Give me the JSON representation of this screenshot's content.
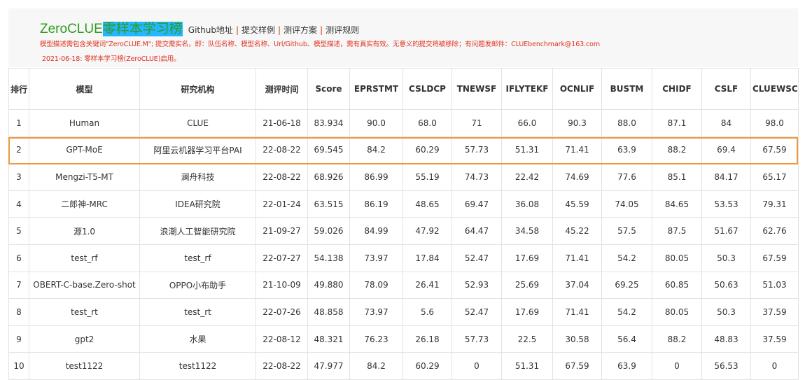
{
  "header": {
    "brand_prefix": "ZeroCLUE",
    "brand_highlight": "零样本学习榜",
    "nav": [
      "Github地址",
      "提交样例",
      "测评方案",
      "测评规则"
    ]
  },
  "notice": {
    "line1": "模型描述需包含关键词\"ZeroCLUE.M\"; 提交需实名，即：队伍名称、模型名称、Url/Github、模型描述，需有真实有效。无意义的提交将被移除；有问题发邮件：CLUEbenchmark@163.com",
    "line2": "2021-06-18: 零样本学习榜(ZeroCLUE)启用。"
  },
  "colors": {
    "brand": "#2f9a1f",
    "brand_highlight_bg": "#22b7ff",
    "notice": "#e0301e",
    "model_link": "#3b5fc0",
    "best_value": "#e0301e",
    "selected_row_outline": "#f0973a"
  },
  "table": {
    "columns": [
      "排行",
      "模型",
      "研究机构",
      "测评时间",
      "Score",
      "EPRSTMT",
      "CSLDCP",
      "TNEWSF",
      "IFLYTEKF",
      "OCNLIF",
      "BUSTM",
      "CHIDF",
      "CSLF",
      "CLUEWSCF"
    ],
    "highlighted_rank": "2",
    "rows": [
      {
        "rank": "1",
        "model": "Human",
        "org": "CLUE",
        "date": "21-06-18",
        "score": "83.934",
        "eprstmt": "90.0",
        "csldcp": "68.0",
        "tnewsf": "71",
        "iflytekf": "66.0",
        "ocnlif": "90.3",
        "bustm": "88.0",
        "chidf": "87.1",
        "cslf": "84",
        "cluewscf": "98.0",
        "red": [
          "score",
          "eprstmt",
          "csldcp",
          "iflytekf",
          "ocnlif",
          "bustm",
          "cluewscf"
        ]
      },
      {
        "rank": "2",
        "model": "GPT-MoE",
        "org": "阿里云机器学习平台PAI",
        "date": "22-08-22",
        "score": "69.545",
        "eprstmt": "84.2",
        "csldcp": "60.29",
        "tnewsf": "57.73",
        "iflytekf": "51.31",
        "ocnlif": "71.41",
        "bustm": "63.9",
        "chidf": "88.2",
        "cslf": "69.4",
        "cluewscf": "67.59",
        "red": []
      },
      {
        "rank": "3",
        "model": "Mengzi-T5-MT",
        "org": "澜舟科技",
        "date": "22-08-22",
        "score": "68.926",
        "eprstmt": "86.99",
        "csldcp": "55.19",
        "tnewsf": "74.73",
        "iflytekf": "22.42",
        "ocnlif": "74.69",
        "bustm": "77.6",
        "chidf": "85.1",
        "cslf": "84.17",
        "cluewscf": "65.17",
        "red": [
          "tnewsf",
          "cslf"
        ]
      },
      {
        "rank": "4",
        "model": "二郎神-MRC",
        "org": "IDEA研究院",
        "date": "22-01-24",
        "score": "63.515",
        "eprstmt": "86.19",
        "csldcp": "48.65",
        "tnewsf": "69.47",
        "iflytekf": "36.08",
        "ocnlif": "45.59",
        "bustm": "74.05",
        "chidf": "84.65",
        "cslf": "53.53",
        "cluewscf": "79.31",
        "red": []
      },
      {
        "rank": "5",
        "model": "源1.0",
        "org": "浪潮人工智能研究院",
        "date": "21-09-27",
        "score": "59.026",
        "eprstmt": "84.99",
        "csldcp": "47.92",
        "tnewsf": "64.47",
        "iflytekf": "34.58",
        "ocnlif": "45.22",
        "bustm": "57.5",
        "chidf": "87.5",
        "cslf": "51.67",
        "cluewscf": "62.76",
        "red": []
      },
      {
        "rank": "6",
        "model": "test_rf",
        "org": "test_rf",
        "date": "22-07-27",
        "score": "54.138",
        "eprstmt": "73.97",
        "csldcp": "17.84",
        "tnewsf": "52.47",
        "iflytekf": "17.69",
        "ocnlif": "71.41",
        "bustm": "54.2",
        "chidf": "80.05",
        "cslf": "50.3",
        "cluewscf": "67.59",
        "red": []
      },
      {
        "rank": "7",
        "model": "OBERT-C-base.Zero-shot",
        "org": "OPPO小布助手",
        "date": "21-10-09",
        "score": "49.880",
        "eprstmt": "78.09",
        "csldcp": "26.41",
        "tnewsf": "52.93",
        "iflytekf": "25.69",
        "ocnlif": "37.04",
        "bustm": "69.25",
        "chidf": "60.85",
        "cslf": "50.63",
        "cluewscf": "51.03",
        "red": []
      },
      {
        "rank": "8",
        "model": "test_rt",
        "org": "test_rt",
        "date": "22-07-26",
        "score": "48.858",
        "eprstmt": "73.97",
        "csldcp": "5.6",
        "tnewsf": "52.47",
        "iflytekf": "17.69",
        "ocnlif": "71.41",
        "bustm": "54.2",
        "chidf": "80.05",
        "cslf": "50.3",
        "cluewscf": "37.59",
        "red": []
      },
      {
        "rank": "9",
        "model": "gpt2",
        "org": "水果",
        "date": "22-08-12",
        "score": "48.321",
        "eprstmt": "76.23",
        "csldcp": "26.18",
        "tnewsf": "57.73",
        "iflytekf": "22.5",
        "ocnlif": "30.58",
        "bustm": "56.4",
        "chidf": "88.2",
        "cslf": "48.83",
        "cluewscf": "37.59",
        "red": []
      },
      {
        "rank": "10",
        "model": "test1122",
        "org": "test1122",
        "date": "22-08-22",
        "score": "47.977",
        "eprstmt": "84.2",
        "csldcp": "60.29",
        "tnewsf": "0",
        "iflytekf": "51.31",
        "ocnlif": "67.59",
        "bustm": "63.9",
        "chidf": "0",
        "cslf": "56.53",
        "cluewscf": "0",
        "red": []
      }
    ]
  }
}
